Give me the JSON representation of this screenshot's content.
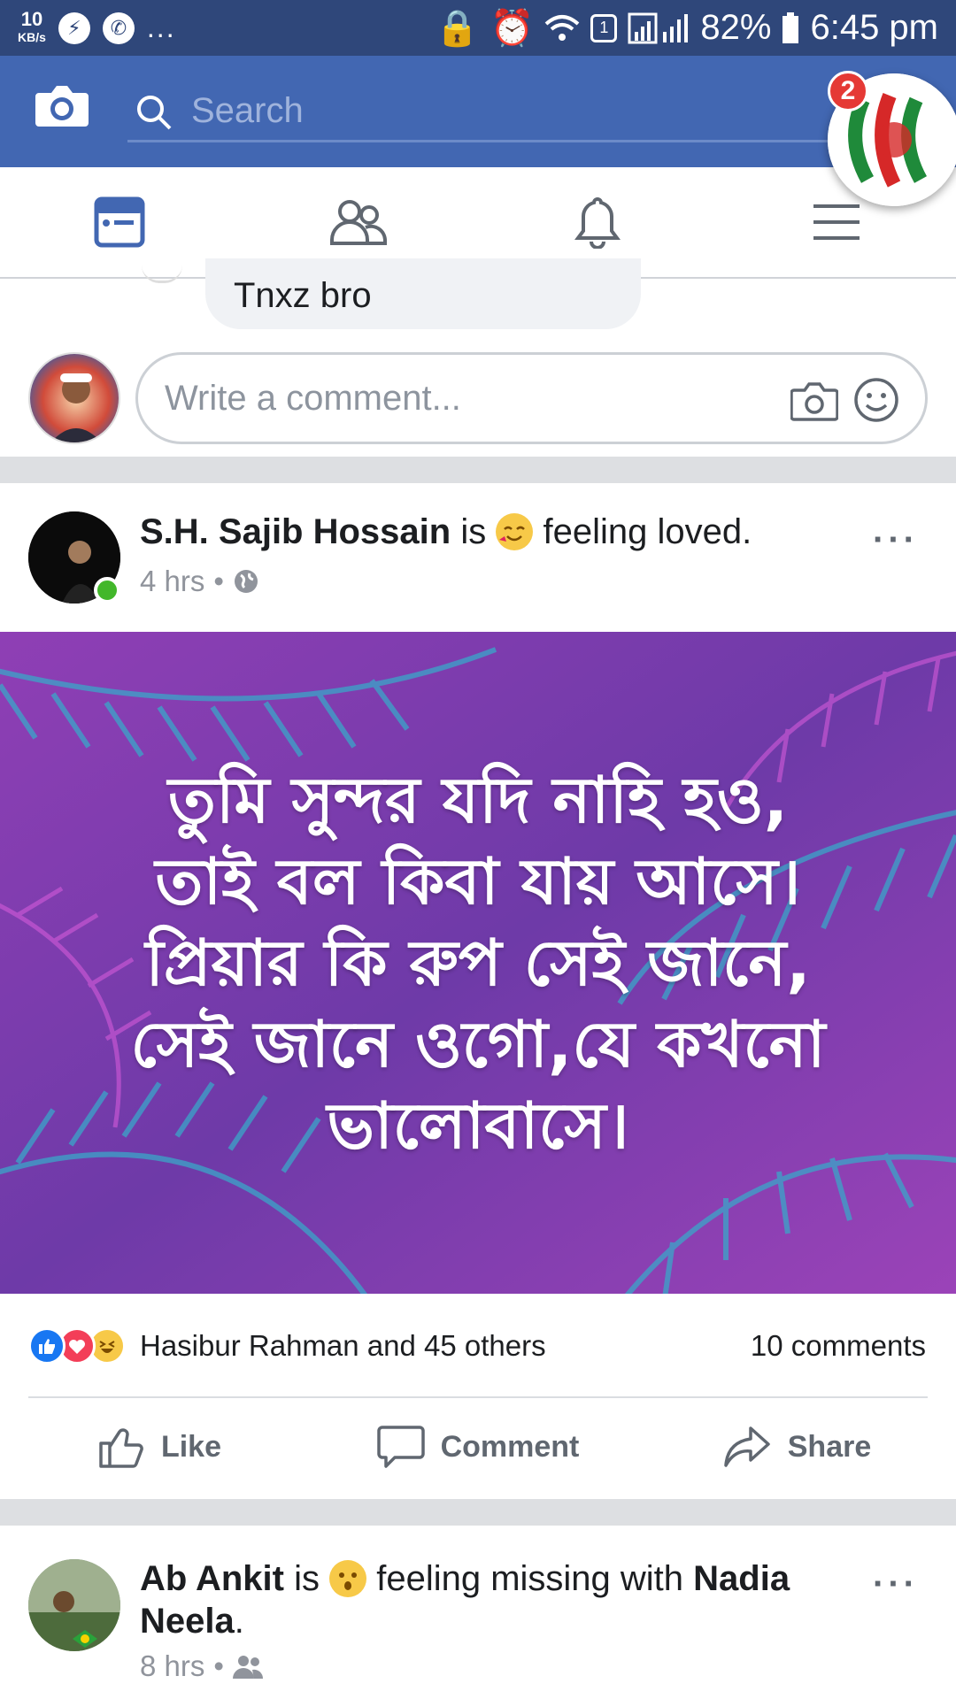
{
  "status_bar": {
    "speed_value": "10",
    "speed_unit": "KB/s",
    "sim_label": "1",
    "battery": "82%",
    "time": "6:45 pm",
    "more": "..."
  },
  "app_bar": {
    "search_placeholder": "Search",
    "notification_badge": "2"
  },
  "previous_comment": {
    "reply_text": "Tnxz bro",
    "comment_placeholder": "Write a comment..."
  },
  "post": {
    "author": "S.H. Sajib Hossain",
    "verb": "is",
    "feeling": "feeling loved.",
    "time": "4 hrs",
    "more": "···",
    "image_text_lines": [
      "তুমি সুন্দর যদি নাহি হও,",
      "তাই বল কিবা যায় আসে।",
      "প্রিয়ার কি রুপ সেই জানে,",
      "সেই জানে ওগো,যে কখনো",
      "ভালোবাসে।"
    ],
    "reactions_text": "Hasibur Rahman and 45 others",
    "comments_count": "10 comments",
    "actions": {
      "like": "Like",
      "comment": "Comment",
      "share": "Share"
    }
  },
  "post2": {
    "author": "Ab Ankit",
    "verb": "is",
    "feeling": "feeling missing with",
    "tagged": "Nadia Neela",
    "period": ".",
    "time": "8 hrs",
    "more": "···"
  },
  "colors": {
    "brand_blue": "#4267b2",
    "status_bar": "#2f477a",
    "active_tab": "#4267b2",
    "post_bg": "#7a3bb0"
  }
}
